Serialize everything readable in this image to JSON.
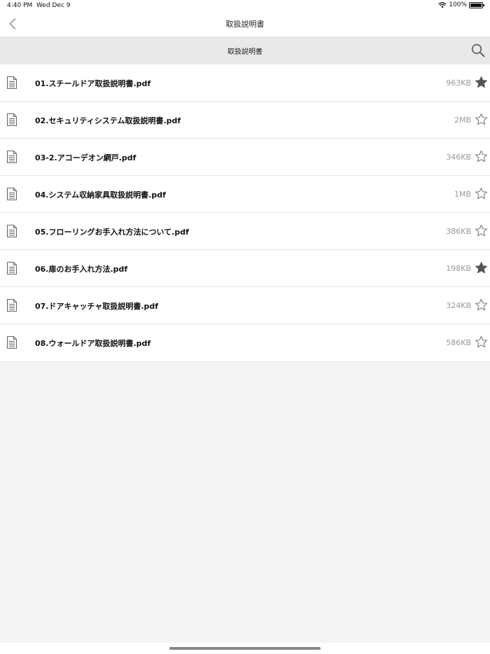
{
  "status_bar": {
    "time": "4:40 PM",
    "date": "Wed Dec 9",
    "battery": "100%",
    "wifi_icon": "wifi-icon",
    "battery_icon": "battery-icon"
  },
  "nav": {
    "title": "取扱説明書",
    "back_icon": "chevron-left-icon"
  },
  "folder": {
    "title": "取扱説明書",
    "search_icon": "search-icon"
  },
  "files": [
    {
      "name": "01.スチールドア取扱説明書.pdf",
      "size": "963KB",
      "favorite": true
    },
    {
      "name": "02.セキュリティシステム取扱説明書.pdf",
      "size": "2MB",
      "favorite": false
    },
    {
      "name": "03-2.アコーデオン網戸.pdf",
      "size": "346KB",
      "favorite": false
    },
    {
      "name": "04.システム収納家具取扱説明書.pdf",
      "size": "1MB",
      "favorite": false
    },
    {
      "name": "05.フローリングお手入れ方法について.pdf",
      "size": "386KB",
      "favorite": false
    },
    {
      "name": "06.扉のお手入れ方法.pdf",
      "size": "198KB",
      "favorite": true
    },
    {
      "name": "07.ドアキャッチャ取扱説明書.pdf",
      "size": "324KB",
      "favorite": false
    },
    {
      "name": "08.ウォールドア取扱説明書.pdf",
      "size": "586KB",
      "favorite": false
    }
  ],
  "colors": {
    "background": "#f4f4f4",
    "header_bar": "#e9e9e9",
    "star_filled": "#555555",
    "star_outline": "#777777",
    "size_text": "#9a9a9a"
  }
}
